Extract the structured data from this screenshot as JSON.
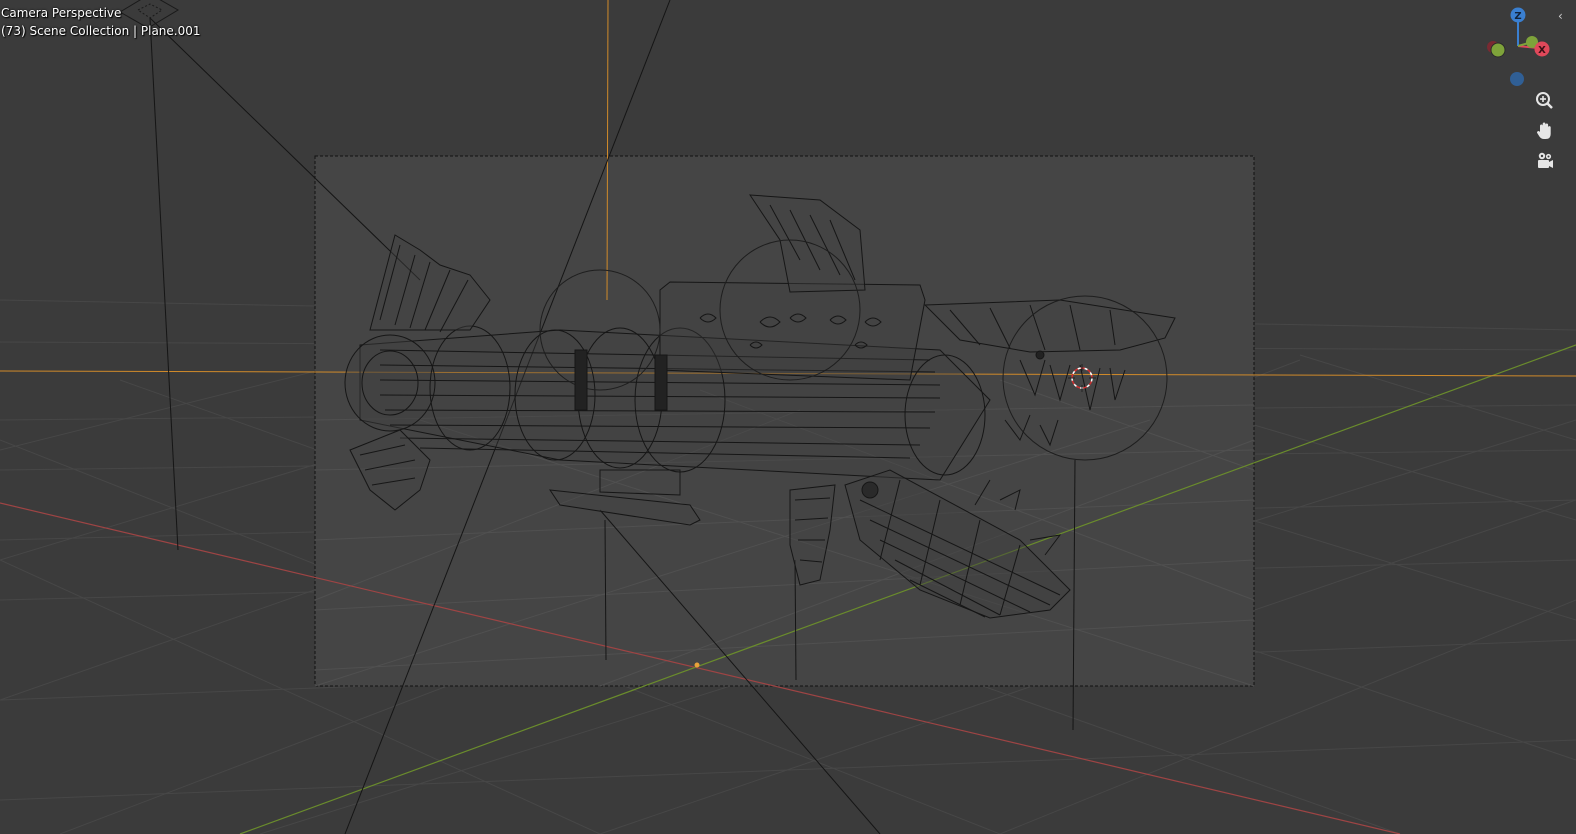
{
  "viewport": {
    "camera_label": "Camera Perspective",
    "scene_info": "(73) Scene Collection | Plane.001"
  },
  "gizmo": {
    "axes": [
      "Z",
      "X"
    ],
    "colors": {
      "x": "#e0485a",
      "y": "#7ea33a",
      "z": "#3a7fd0"
    }
  },
  "side_tools": [
    "zoom-icon",
    "pan-hand-icon",
    "camera-view-icon"
  ],
  "colors": {
    "background": "#3a3a3a",
    "camera_frame": "#444444",
    "grid": "#4a4a4a",
    "x_axis": "#b04646",
    "y_axis": "#6a8c2c",
    "orange_lines": "#d08a2a",
    "wire": "#161616"
  }
}
